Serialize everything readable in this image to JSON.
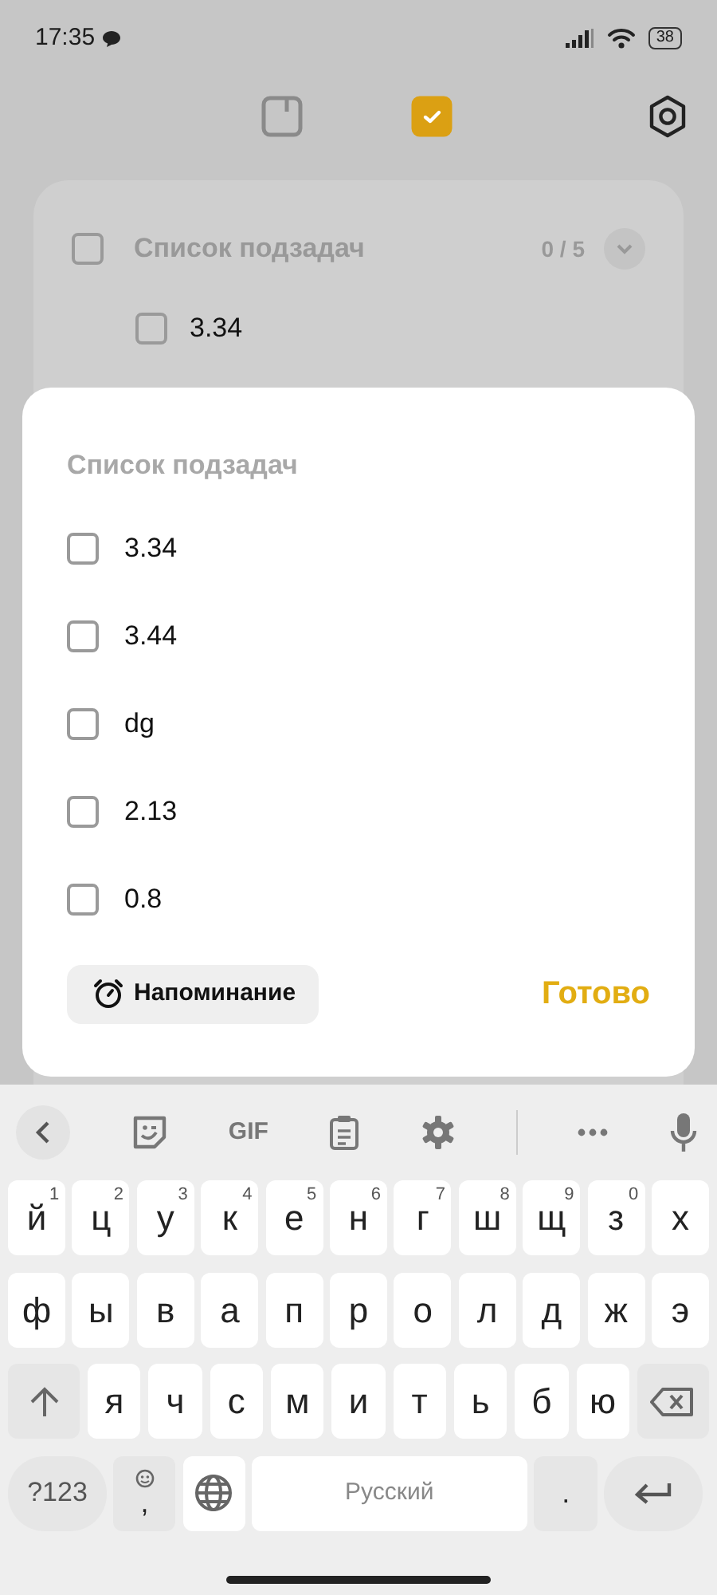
{
  "status_bar": {
    "time": "17:35",
    "battery": "38"
  },
  "view_tabs": [
    {
      "kind": "note",
      "selected": false
    },
    {
      "kind": "todo",
      "selected": true
    }
  ],
  "background_card": {
    "title": "Список подзадач",
    "checked": false,
    "count": "0 / 5",
    "expanded": false,
    "items": [
      {
        "text": "3.34",
        "checked": false
      }
    ]
  },
  "sheet": {
    "title": "Список подзадач",
    "items": [
      {
        "text": "3.34",
        "checked": false
      },
      {
        "text": "3.44",
        "checked": false
      },
      {
        "text": "dg",
        "checked": false
      },
      {
        "text": "2.13",
        "checked": false
      },
      {
        "text": "0.8",
        "checked": false
      }
    ],
    "reminder_button": "Напоминание",
    "done_button": "Готово"
  },
  "keyboard": {
    "toolbar": [
      {
        "kind": "back"
      },
      {
        "kind": "sticker"
      },
      {
        "kind": "gif",
        "label": "GIF"
      },
      {
        "kind": "clipboard"
      },
      {
        "kind": "settings"
      },
      {
        "kind": "divider"
      },
      {
        "kind": "more"
      },
      {
        "kind": "mic"
      }
    ],
    "rows": [
      [
        {
          "kind": "letter",
          "label": "й",
          "hint": "1"
        },
        {
          "kind": "letter",
          "label": "ц",
          "hint": "2"
        },
        {
          "kind": "letter",
          "label": "у",
          "hint": "3"
        },
        {
          "kind": "letter",
          "label": "к",
          "hint": "4"
        },
        {
          "kind": "letter",
          "label": "е",
          "hint": "5"
        },
        {
          "kind": "letter",
          "label": "н",
          "hint": "6"
        },
        {
          "kind": "letter",
          "label": "г",
          "hint": "7"
        },
        {
          "kind": "letter",
          "label": "ш",
          "hint": "8"
        },
        {
          "kind": "letter",
          "label": "щ",
          "hint": "9"
        },
        {
          "kind": "letter",
          "label": "з",
          "hint": "0"
        },
        {
          "kind": "letter",
          "label": "х"
        }
      ],
      [
        {
          "kind": "letter",
          "label": "ф"
        },
        {
          "kind": "letter",
          "label": "ы"
        },
        {
          "kind": "letter",
          "label": "в"
        },
        {
          "kind": "letter",
          "label": "а"
        },
        {
          "kind": "letter",
          "label": "п"
        },
        {
          "kind": "letter",
          "label": "р"
        },
        {
          "kind": "letter",
          "label": "о"
        },
        {
          "kind": "letter",
          "label": "л"
        },
        {
          "kind": "letter",
          "label": "д"
        },
        {
          "kind": "letter",
          "label": "ж"
        },
        {
          "kind": "letter",
          "label": "э"
        }
      ],
      [
        {
          "kind": "shift"
        },
        {
          "kind": "letter",
          "label": "я"
        },
        {
          "kind": "letter",
          "label": "ч"
        },
        {
          "kind": "letter",
          "label": "с"
        },
        {
          "kind": "letter",
          "label": "м"
        },
        {
          "kind": "letter",
          "label": "и"
        },
        {
          "kind": "letter",
          "label": "т"
        },
        {
          "kind": "letter",
          "label": "ь"
        },
        {
          "kind": "letter",
          "label": "б"
        },
        {
          "kind": "letter",
          "label": "ю"
        },
        {
          "kind": "backspace"
        }
      ]
    ],
    "bottom_row": {
      "symbols_key": "?123",
      "comma_key": ",",
      "space_key": "Русский",
      "period_key": "."
    }
  }
}
